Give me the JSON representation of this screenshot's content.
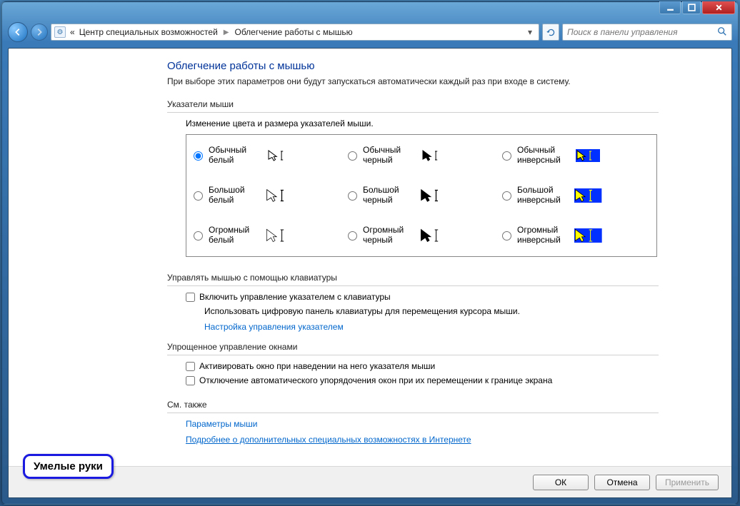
{
  "titlebar": {
    "minimize": "_",
    "maximize": "□",
    "close": "✕"
  },
  "nav": {
    "breadcrumb_prefix": "«",
    "breadcrumb1": "Центр специальных возможностей",
    "breadcrumb2": "Облегчение работы с мышью",
    "search_placeholder": "Поиск в панели управления"
  },
  "page": {
    "title": "Облегчение работы с мышью",
    "subtitle": "При выборе этих параметров они будут запускаться автоматически каждый раз при входе в систему."
  },
  "section_pointers": {
    "label": "Указатели мыши",
    "sublabel": "Изменение цвета и размера указателей мыши.",
    "options": [
      {
        "label": "Обычный белый",
        "scheme": "white",
        "size": "s",
        "checked": true
      },
      {
        "label": "Обычный черный",
        "scheme": "black",
        "size": "s"
      },
      {
        "label": "Обычный инверсный",
        "scheme": "inv",
        "size": "s"
      },
      {
        "label": "Большой белый",
        "scheme": "white",
        "size": "m"
      },
      {
        "label": "Большой черный",
        "scheme": "black",
        "size": "m"
      },
      {
        "label": "Большой инверсный",
        "scheme": "inv",
        "size": "m"
      },
      {
        "label": "Огромный белый",
        "scheme": "white",
        "size": "l"
      },
      {
        "label": "Огромный черный",
        "scheme": "black",
        "size": "l"
      },
      {
        "label": "Огромный инверсный",
        "scheme": "inv",
        "size": "l"
      }
    ]
  },
  "section_keyboard": {
    "label": "Управлять мышью с помощью клавиатуры",
    "checkbox": "Включить управление указателем с клавиатуры",
    "desc": "Использовать цифровую панель клавиатуры для перемещения курсора мыши.",
    "link": "Настройка управления указателем"
  },
  "section_windows": {
    "label": "Упрощенное управление окнами",
    "check1": "Активировать окно при наведении на него указателя мыши",
    "check2": "Отключение автоматического упорядочения окон при их перемещении к границе экрана"
  },
  "section_seealso": {
    "label": "См. также",
    "link1": "Параметры мыши",
    "link2": "Подробнее о дополнительных специальных возможностях в Интернете"
  },
  "buttons": {
    "ok": "ОК",
    "cancel": "Отмена",
    "apply": "Применить"
  },
  "badge": "Умелые руки"
}
